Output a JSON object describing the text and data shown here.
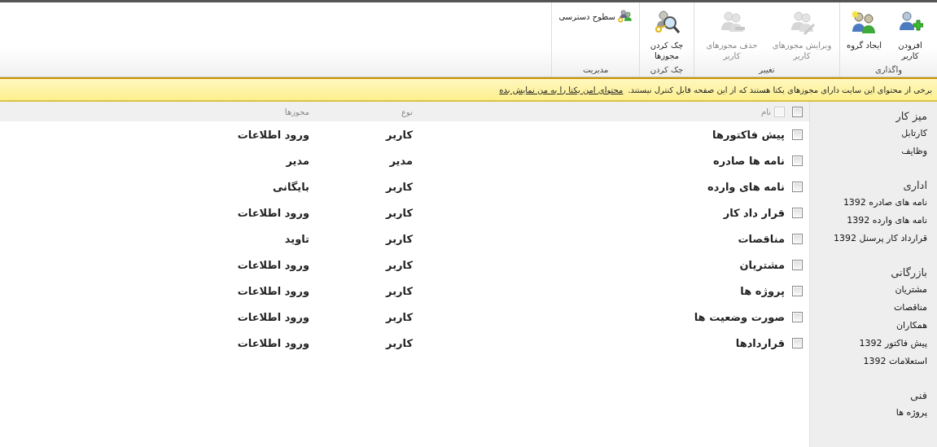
{
  "ribbon": {
    "groups": [
      {
        "label": "واگذاری",
        "buttons": [
          {
            "kind": "large",
            "label": "افزودن کاربر",
            "disabled": false
          },
          {
            "kind": "large",
            "label": "ایجاد گروه",
            "disabled": false
          }
        ]
      },
      {
        "label": "تغییر",
        "buttons": [
          {
            "kind": "large",
            "label": "ویرایش مجوزهای کاربر",
            "disabled": true
          },
          {
            "kind": "large",
            "label": "حذف مجوزهای کاربر",
            "disabled": true
          }
        ]
      },
      {
        "label": "چک کردن",
        "buttons": [
          {
            "kind": "large",
            "label": "چک کردن مجوزها",
            "disabled": false
          }
        ]
      },
      {
        "label": "مدیریت",
        "buttons": [
          {
            "kind": "small",
            "label": "سطوح دسترسی",
            "disabled": false
          }
        ]
      }
    ]
  },
  "notice": {
    "message": "برخی از محتوای این سایت دارای مجوزهای یکتا هستند که از این صفحه قابل کنترل نیستند.",
    "link": "محتوای امن یکتا را به من نمایش بده"
  },
  "sidebar": {
    "sections": [
      {
        "heading": "میز کار",
        "items": [
          "کارتابل",
          "وظایف"
        ]
      },
      {
        "heading": "اداری",
        "items": [
          "نامه های صادره 1392",
          "نامه های وارده 1392",
          "قرارداد کار پرسنل 1392"
        ]
      },
      {
        "heading": "بازرگانی",
        "items": [
          "مشتریان",
          "مناقصات",
          "همکاران",
          "پیش فاکتور 1392",
          "استعلامات 1392"
        ]
      },
      {
        "heading": "فنی",
        "items": [
          "پروژه ها"
        ]
      }
    ]
  },
  "table": {
    "select_all": {
      "checked": false
    },
    "columns": [
      {
        "label": "نام",
        "checkbox": {
          "checked": false,
          "disabled": true
        }
      },
      {
        "label": "نوع"
      },
      {
        "label": "مجوزها"
      }
    ],
    "rows": [
      {
        "checked": false,
        "name": "پیش فاکتورها",
        "type": "کاربر",
        "permissions": "ورود اطلاعات"
      },
      {
        "checked": false,
        "name": "نامه ها صادره",
        "type": "مدیر",
        "permissions": "مدیر"
      },
      {
        "checked": false,
        "name": "نامه های وارده",
        "type": "کاربر",
        "permissions": "بایگانی"
      },
      {
        "checked": false,
        "name": "قرار داد کار",
        "type": "کاربر",
        "permissions": "ورود اطلاعات"
      },
      {
        "checked": false,
        "name": "مناقصات",
        "type": "کاربر",
        "permissions": "تاوید"
      },
      {
        "checked": false,
        "name": "مشتریان",
        "type": "کاربر",
        "permissions": "ورود اطلاعات"
      },
      {
        "checked": false,
        "name": "پروژه ها",
        "type": "کاربر",
        "permissions": "ورود اطلاعات"
      },
      {
        "checked": false,
        "name": "صورت وضعیت ها",
        "type": "کاربر",
        "permissions": "ورود اطلاعات"
      },
      {
        "checked": false,
        "name": "قراردادها",
        "type": "کاربر",
        "permissions": "ورود اطلاعات"
      }
    ]
  }
}
